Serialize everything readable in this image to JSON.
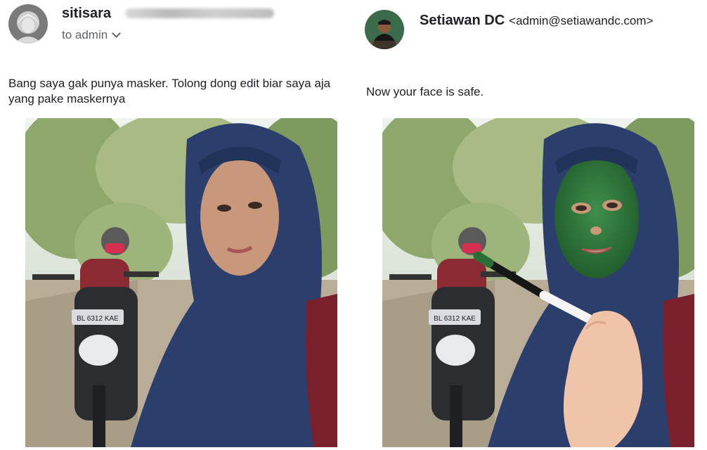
{
  "left_message": {
    "sender": "sitisara",
    "recipient_line": "to admin",
    "body": "Bang saya gak punya masker. Tolong dong edit biar saya aja yang pake maskernya",
    "plate_text": "BL 6312 KAE"
  },
  "right_message": {
    "sender": "Setiawan DC",
    "email": "<admin@setiawandc.com>",
    "body": "Now your face is safe.",
    "plate_text": "BL 6312 KAE"
  },
  "icons": {
    "recipient_dropdown": "chevron-down-icon"
  },
  "colors": {
    "hijab": "#2c3e6b",
    "face_mask_green": "#2f7a3c",
    "text": "#202124",
    "muted": "#5f6368"
  }
}
